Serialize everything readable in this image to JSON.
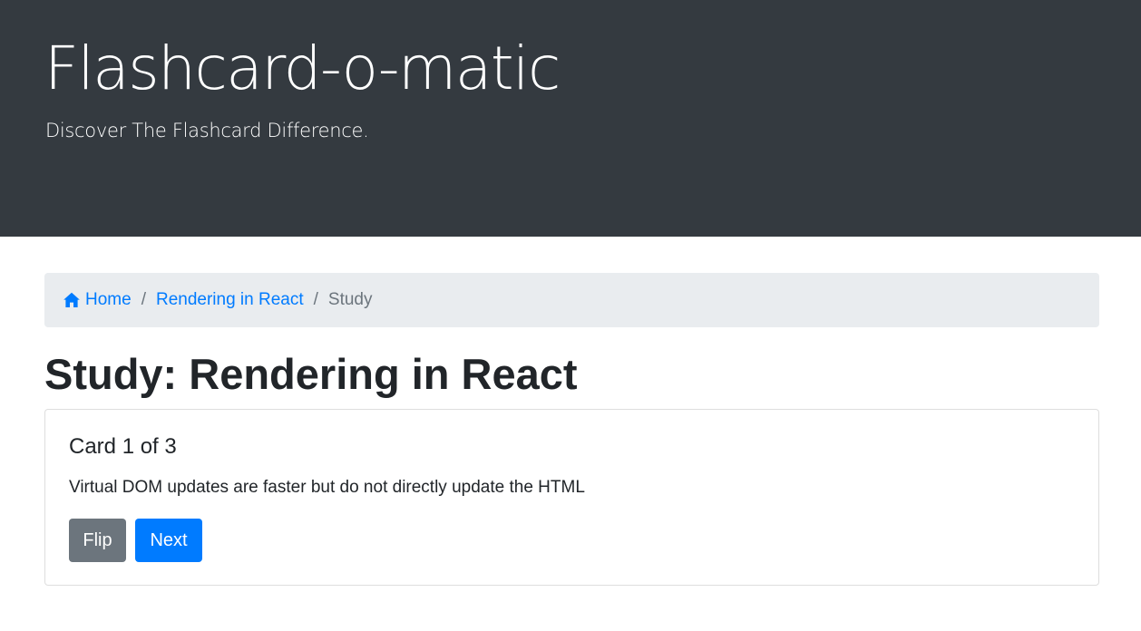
{
  "header": {
    "title": "Flashcard-o-matic",
    "tagline": "Discover The Flashcard Difference."
  },
  "breadcrumb": {
    "home_icon": "house-icon",
    "home_label": "Home",
    "deck_label": "Rendering in React",
    "current_label": "Study",
    "separator": "/"
  },
  "page": {
    "heading": "Study: Rendering in React"
  },
  "card": {
    "title": "Card 1 of 3",
    "text": "Virtual DOM updates are faster but do not directly update the HTML",
    "flip_label": "Flip",
    "next_label": "Next"
  },
  "colors": {
    "header_bg": "#343a40",
    "breadcrumb_bg": "#e9ecef",
    "link": "#007bff",
    "secondary": "#6c757d",
    "primary": "#007bff"
  }
}
